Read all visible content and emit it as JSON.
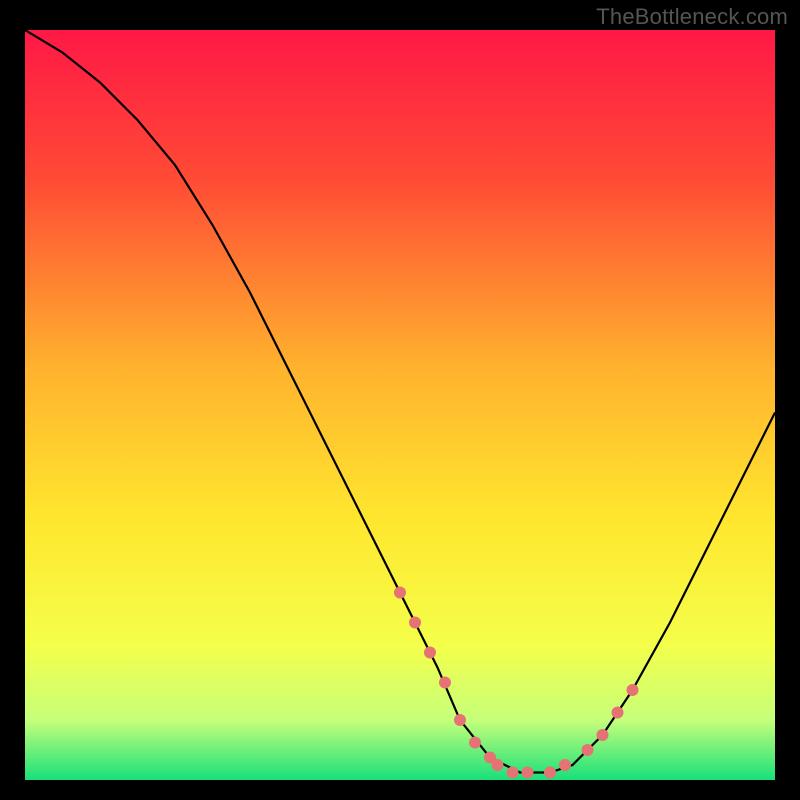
{
  "watermark": "TheBottleneck.com",
  "chart_data": {
    "type": "line",
    "title": "",
    "xlabel": "",
    "ylabel": "",
    "xlim": [
      0,
      100
    ],
    "ylim": [
      0,
      100
    ],
    "background_gradient": [
      {
        "stop": 0,
        "color": "#ff1846"
      },
      {
        "stop": 20,
        "color": "#ff4b35"
      },
      {
        "stop": 45,
        "color": "#ffb22e"
      },
      {
        "stop": 65,
        "color": "#ffe62e"
      },
      {
        "stop": 82,
        "color": "#f4ff4a"
      },
      {
        "stop": 92,
        "color": "#c6ff7a"
      },
      {
        "stop": 100,
        "color": "#18e07a"
      }
    ],
    "series": [
      {
        "name": "bottleneck-curve",
        "x": [
          0,
          5,
          10,
          15,
          20,
          25,
          30,
          35,
          40,
          45,
          50,
          55,
          58,
          62,
          66,
          70,
          73,
          77,
          81,
          86,
          91,
          96,
          100
        ],
        "y": [
          100,
          97,
          93,
          88,
          82,
          74,
          65,
          55,
          45,
          35,
          25,
          15,
          8,
          3,
          1,
          1,
          2,
          6,
          12,
          21,
          31,
          41,
          49
        ]
      }
    ],
    "highlight_points": {
      "name": "marked-range",
      "x": [
        50,
        52,
        54,
        56,
        58,
        60,
        62,
        63,
        65,
        67,
        70,
        72,
        75,
        77,
        79,
        81
      ],
      "y": [
        25,
        21,
        17,
        13,
        8,
        5,
        3,
        2,
        1,
        1,
        1,
        2,
        4,
        6,
        9,
        12
      ],
      "color": "#e57373",
      "radius": 6
    }
  }
}
